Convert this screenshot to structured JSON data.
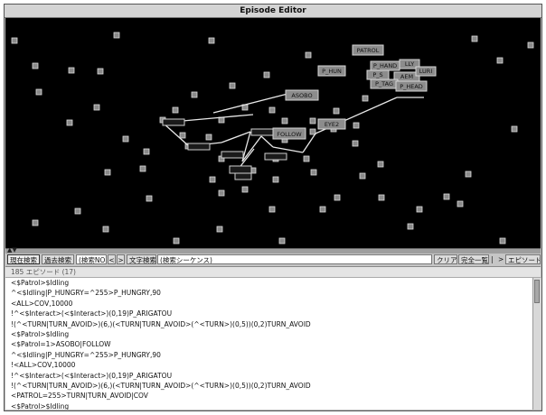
{
  "window": {
    "title": "Episode Editor"
  },
  "graph": {
    "node_labels": [
      "PATROL",
      "P_HUN",
      "P_HAND",
      "P_S",
      "LLY",
      "AEM",
      "LURI",
      "P_TAG",
      "P_HEAD",
      "ASOBO",
      "FOLLOW",
      "EYE2"
    ]
  },
  "toolbar": {
    "current_search": "現在検索",
    "past_search": "過去検索",
    "search_no_placeholder": "(検索NO.)",
    "prev": "<",
    "next": ">",
    "text_search": "文字検索",
    "sequence_placeholder": "(検索シーケンス)",
    "clear": "クリア",
    "full_list": "完全一覧",
    "pipe": "|",
    "arrow": ">",
    "create_episode": "エピソード作成"
  },
  "list": {
    "header": "185 エピソード (17)",
    "rows": [
      "<$Patrol>$Idling",
      "^<$Idling|P_HUNGRY=^255>P_HUNGRY,90",
      "<ALL>COV,10000",
      "!^<$Interact>(<$Interact>)(0,19)P_ARIGATOU",
      "!(^<TURN|TURN_AVOID>)(6,)(<TURN|TURN_AVOID>(^<TURN>)(0,5))(0,2)TURN_AVOID",
      "<$Patrol>$Idling",
      "<$Patrol=1>ASOBO|FOLLOW",
      "^<$Idling|P_HUNGRY=^255>P_HUNGRY,90",
      "!<ALL>COV,10000",
      "!^<$Interact>(<$Interact>)(0,19)P_ARIGATOU",
      "!(^<TURN|TURN_AVOID>)(6,)(<TURN|TURN_AVOID>(^<TURN>)(0,5))(0,2)TURN_AVOID",
      "<PATROL=255>TURN|TURN_AVOID|COV",
      "<$Patrol>$Idling"
    ]
  }
}
